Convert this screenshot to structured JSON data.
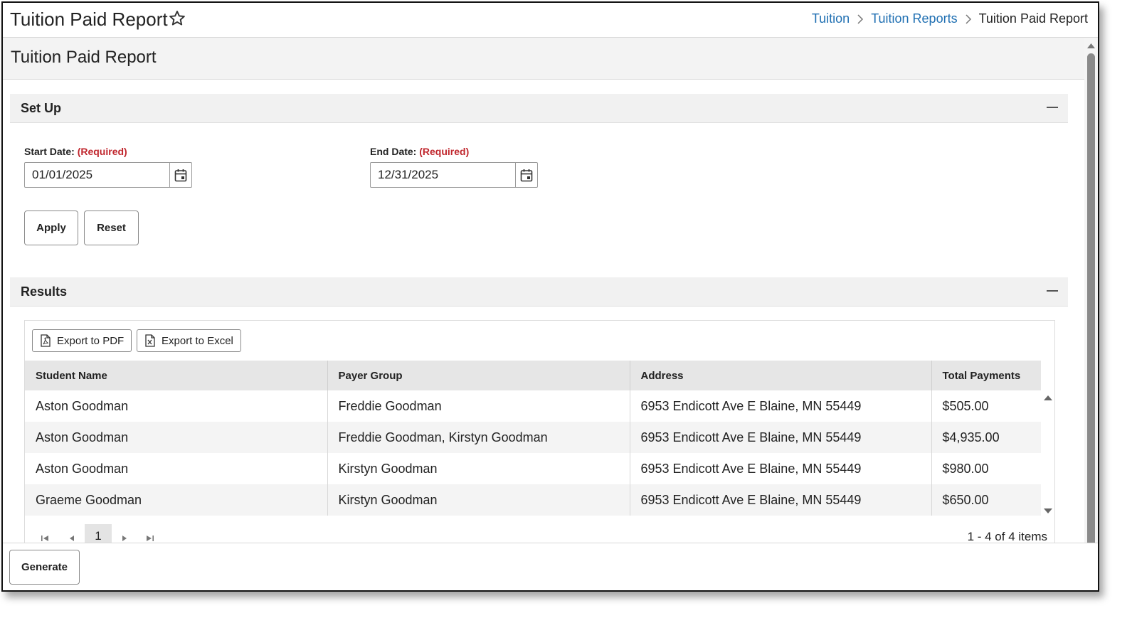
{
  "topbar": {
    "title": "Tuition Paid Report",
    "breadcrumb": [
      "Tuition",
      "Tuition Reports",
      "Tuition Paid Report"
    ]
  },
  "header": {
    "title": "Tuition Paid Report"
  },
  "setup": {
    "label": "Set Up",
    "start_date_label": "Start Date:",
    "start_date_required": "(Required)",
    "start_date_value": "01/01/2025",
    "end_date_label": "End Date:",
    "end_date_required": "(Required)",
    "end_date_value": "12/31/2025",
    "apply_label": "Apply",
    "reset_label": "Reset"
  },
  "results": {
    "label": "Results",
    "export_pdf_label": "Export to PDF",
    "export_excel_label": "Export to Excel",
    "columns": [
      "Student Name",
      "Payer Group",
      "Address",
      "Total Payments"
    ],
    "rows": [
      [
        "Aston Goodman",
        "Freddie Goodman",
        "6953 Endicott Ave E Blaine, MN 55449",
        "$505.00"
      ],
      [
        "Aston Goodman",
        "Freddie Goodman, Kirstyn Goodman",
        "6953 Endicott Ave E Blaine, MN 55449",
        "$4,935.00"
      ],
      [
        "Aston Goodman",
        "Kirstyn Goodman",
        "6953 Endicott Ave E Blaine, MN 55449",
        "$980.00"
      ],
      [
        "Graeme Goodman",
        "Kirstyn Goodman",
        "6953 Endicott Ave E Blaine, MN 55449",
        "$650.00"
      ]
    ],
    "pager": {
      "current_page": "1",
      "info": "1 - 4 of 4 items"
    }
  },
  "footer": {
    "generate_label": "Generate"
  },
  "colors": {
    "link": "#1f6fb2",
    "required": "#c0262d",
    "header_bg": "#e6e6e6"
  }
}
